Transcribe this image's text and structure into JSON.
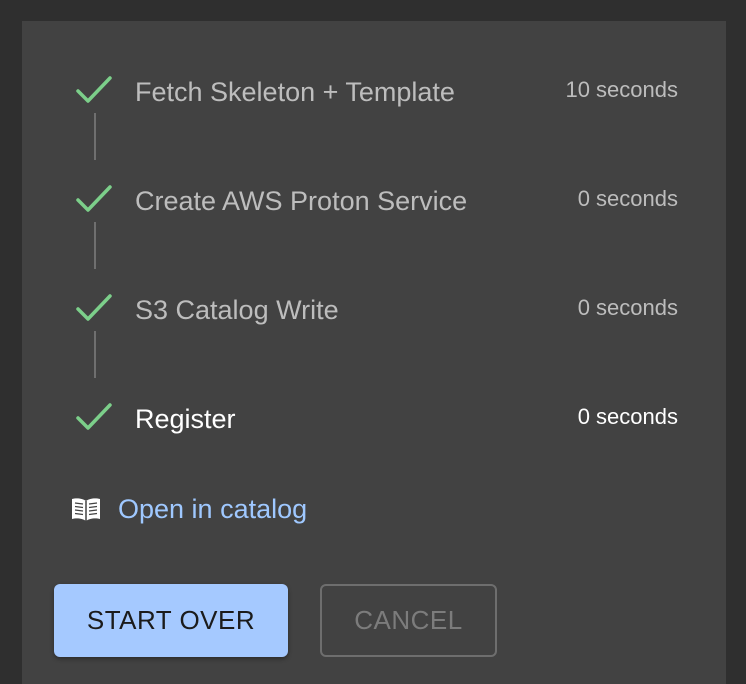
{
  "steps": [
    {
      "label": "Fetch Skeleton + Template",
      "duration": "10 seconds",
      "status": "completed"
    },
    {
      "label": "Create AWS Proton Service",
      "duration": "0 seconds",
      "status": "completed"
    },
    {
      "label": "S3 Catalog Write",
      "duration": "0 seconds",
      "status": "completed"
    },
    {
      "label": "Register",
      "duration": "0 seconds",
      "status": "completed"
    }
  ],
  "links": {
    "open_catalog": {
      "label": "Open in catalog",
      "icon": "book-open-icon"
    }
  },
  "actions": {
    "start_over_label": "START OVER",
    "cancel_label": "CANCEL"
  },
  "colors": {
    "check": "#7ccf8a",
    "link": "#9fc8ff",
    "primary_button": "#a5c9ff"
  }
}
